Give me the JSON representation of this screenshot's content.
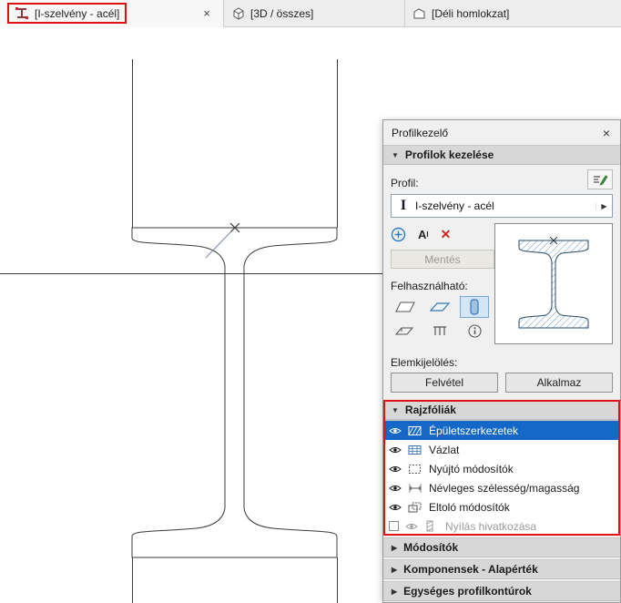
{
  "tabs": {
    "profile": {
      "label": "[I-szelvény - acél]",
      "close": "×"
    },
    "three_d": {
      "label": "[3D / összes]"
    },
    "elevation": {
      "label": "[Déli homlokzat]"
    }
  },
  "panel": {
    "title": "Profilkezelő",
    "close": "×",
    "section_profiles": "Profilok kezelése",
    "profil_label": "Profil:",
    "profile_glyph": "I",
    "profile_selected": "I-szelvény - acél",
    "save_button": "Mentés",
    "usable_label": "Felhasználható:",
    "selection_label": "Elemkijelölés:",
    "pickup_button": "Felvétel",
    "apply_button": "Alkalmaz",
    "section_layers": "Rajzfóliák",
    "section_modifiers": "Módosítók",
    "section_components": "Komponensek - Alapérték",
    "section_contours": "Egységes profilkontúrok",
    "layers": [
      {
        "label": "Épületszerkezetek",
        "selected": true
      },
      {
        "label": "Vázlat"
      },
      {
        "label": "Nyújtó módosítók"
      },
      {
        "label": "Névleges szélesség/magasság"
      },
      {
        "label": "Eltoló módosítók"
      },
      {
        "label": "Nyílás hivatkozása",
        "disabled": true
      }
    ]
  },
  "icons": {
    "section_open": "▼",
    "section_closed": "▶",
    "dropdown_arrow": "▶",
    "delete": "✕",
    "text_a": "A",
    "text_a_sup": "I"
  },
  "colors": {
    "annotation_red": "#dd1111",
    "selection_blue": "#1568c8",
    "hatch_blue": "#6d9ec7"
  }
}
